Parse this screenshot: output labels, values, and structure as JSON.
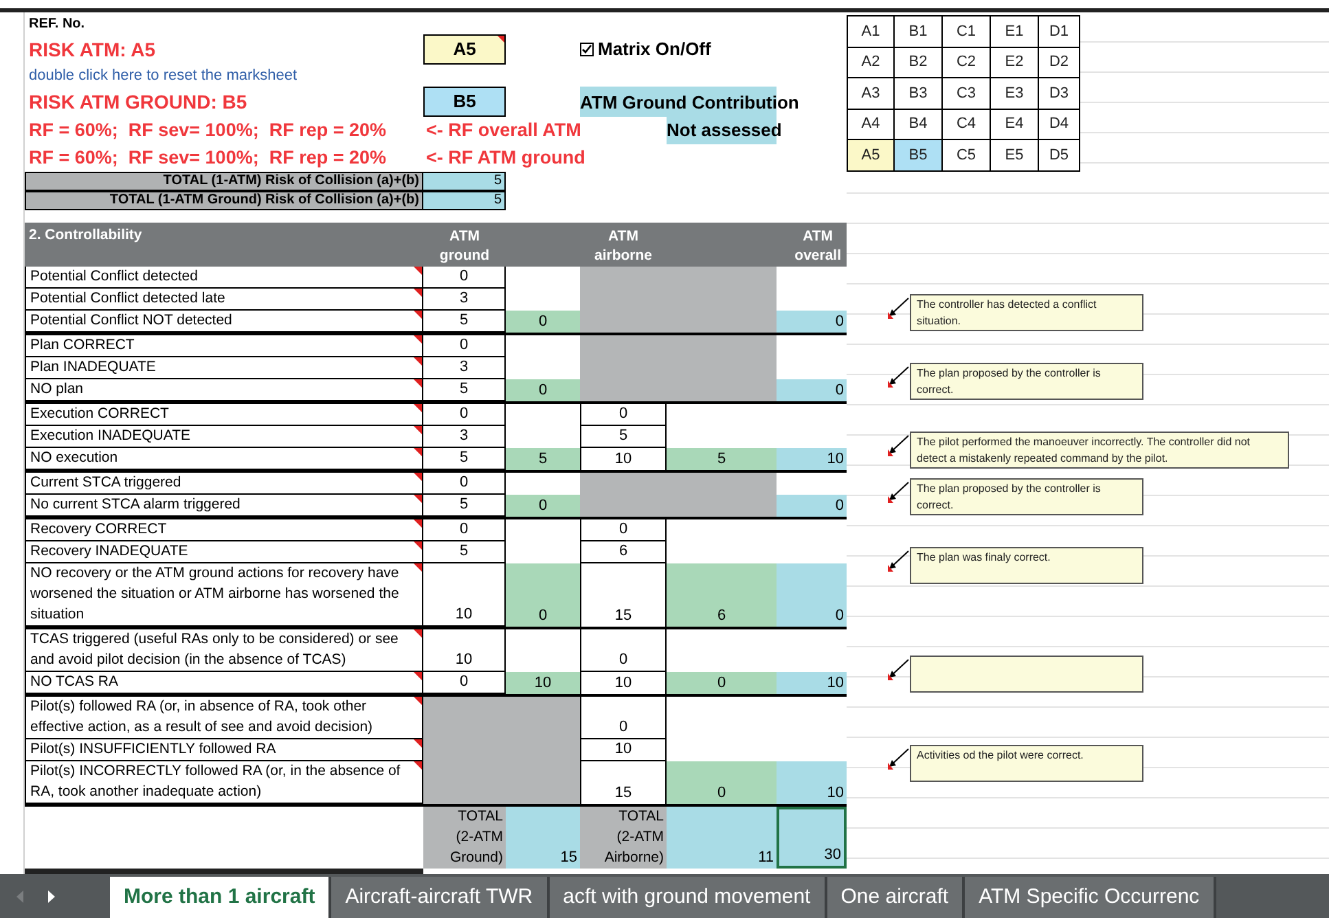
{
  "ref_label": "REF. No.",
  "risk_atm": {
    "label": "RISK ATM: A5",
    "value": "A5"
  },
  "matrix_toggle": {
    "label": "Matrix On/Off",
    "checked": true
  },
  "reset_link": "double click here to reset the marksheet",
  "risk_atm_ground": {
    "label": "RISK ATM GROUND: B5",
    "value": "B5"
  },
  "ground_contribution": {
    "label": "ATM Ground Contribution",
    "status": "Not assessed"
  },
  "rf_rows": [
    {
      "factors": "RF = 60%;  RF sev= 100%;  RF rep = 20%",
      "note": "<- RF overall ATM"
    },
    {
      "factors": "RF = 60%;  RF sev= 100%;  RF rep = 20%",
      "note": "<- RF ATM ground"
    }
  ],
  "collision_totals": [
    {
      "label": "TOTAL (1-ATM) Risk of Collision (a)+(b)",
      "value": "5"
    },
    {
      "label": "TOTAL (1-ATM Ground) Risk of Collision (a)+(b)",
      "value": "5"
    }
  ],
  "matrix": [
    [
      {
        "label": "A1"
      },
      {
        "label": "B1"
      },
      {
        "label": "C1"
      },
      {
        "label": "E1"
      },
      {
        "label": "D1"
      }
    ],
    [
      {
        "label": "A2"
      },
      {
        "label": "B2"
      },
      {
        "label": "C2"
      },
      {
        "label": "E2"
      },
      {
        "label": "D2"
      }
    ],
    [
      {
        "label": "A3"
      },
      {
        "label": "B3"
      },
      {
        "label": "C3"
      },
      {
        "label": "E3"
      },
      {
        "label": "D3"
      }
    ],
    [
      {
        "label": "A4"
      },
      {
        "label": "B4"
      },
      {
        "label": "C4"
      },
      {
        "label": "E4"
      },
      {
        "label": "D4"
      }
    ],
    [
      {
        "label": "A5",
        "color": "#fbf8c8"
      },
      {
        "label": "B5",
        "color": "#aee0f4"
      },
      {
        "label": "C5"
      },
      {
        "label": "E5"
      },
      {
        "label": "D5"
      }
    ]
  ],
  "controllability": {
    "title": "2. Controllability",
    "columns": [
      "ATM ground",
      "ATM airborne",
      "ATM overall"
    ],
    "groups": [
      {
        "airborne_na": true,
        "rows": [
          {
            "label": "Potential Conflict detected",
            "ground": "0"
          },
          {
            "label": "Potential Conflict detected late",
            "ground": "3"
          },
          {
            "label": "Potential Conflict NOT detected",
            "ground": "5",
            "ground_result": "0",
            "overall": "0",
            "comment": {
              "kind": "note",
              "text": "The controller has detected a conflict situation."
            }
          }
        ]
      },
      {
        "airborne_na": true,
        "rows": [
          {
            "label": "Plan CORRECT",
            "ground": "0"
          },
          {
            "label": "Plan INADEQUATE",
            "ground": "3"
          },
          {
            "label": "NO plan",
            "ground": "5",
            "ground_result": "0",
            "overall": "0",
            "comment": {
              "kind": "note",
              "text": "The plan proposed by the controller is correct."
            }
          }
        ]
      },
      {
        "rows": [
          {
            "label": "Execution CORRECT",
            "ground": "0",
            "airborne": "0"
          },
          {
            "label": "Execution INADEQUATE",
            "ground": "3",
            "airborne": "5"
          },
          {
            "label": "NO execution",
            "ground": "5",
            "ground_result": "5",
            "airborne": "10",
            "airborne_result": "5",
            "overall": "10",
            "comment": {
              "kind": "note",
              "text": "The pilot performed the manoeuver incorrectly. The controller did not detect a mistakenly repeated command by the pilot."
            }
          }
        ]
      },
      {
        "airborne_na": true,
        "rows": [
          {
            "label": "Current STCA triggered",
            "ground": "0"
          },
          {
            "label": "No current STCA alarm triggered",
            "ground": "5",
            "ground_result": "0",
            "overall": "0",
            "comment": {
              "kind": "note",
              "text": "The plan proposed by the controller is correct."
            }
          }
        ]
      },
      {
        "rows": [
          {
            "label": "Recovery  CORRECT",
            "ground": "0",
            "airborne": "0"
          },
          {
            "label": "Recovery INADEQUATE",
            "ground": "5",
            "airborne": "6"
          },
          {
            "label": "NO recovery or the ATM ground actions for recovery have worsened the situation or ATM airborne has worsened the situation",
            "ground": "10",
            "ground_result": "0",
            "airborne": "15",
            "airborne_result": "6",
            "overall": "0",
            "comment": {
              "kind": "note",
              "text": "The plan was finaly correct."
            }
          }
        ]
      },
      {
        "rows": [
          {
            "label": "TCAS triggered (useful RAs only to be considered) or see and avoid pilot decision (in the absence of TCAS)",
            "ground": "10",
            "airborne": "0"
          },
          {
            "label": "NO TCAS RA",
            "ground": "0",
            "ground_result": "10",
            "airborne": "10",
            "airborne_result": "0",
            "overall": "10",
            "comment": {
              "kind": "blank"
            }
          }
        ]
      },
      {
        "ground_na": true,
        "rows": [
          {
            "label": "Pilot(s) followed RA (or, in absence of RA, took other effective action, as a result of see and avoid decision)",
            "airborne": "0"
          },
          {
            "label": "Pilot(s) INSUFFICIENTLY followed RA",
            "airborne": "10"
          },
          {
            "label": "Pilot(s) INCORRECTLY followed RA (or, in the absence of RA, took another inadequate action)",
            "airborne": "15",
            "airborne_result": "0",
            "overall": "10",
            "comment": {
              "kind": "note",
              "text": "Activities od the pilot were correct."
            }
          }
        ]
      }
    ],
    "totals": {
      "ground_label": "TOTAL (2-ATM Ground)",
      "ground": "15",
      "airborne_label": "TOTAL (2-ATM Airborne)",
      "airborne": "11",
      "overall": "30"
    }
  },
  "sheet_tabs": [
    {
      "label": "More than 1 aircraft",
      "selected": true
    },
    {
      "label": "Aircraft-aircraft TWR",
      "selected": false
    },
    {
      "label": "acft with ground movement",
      "selected": false
    },
    {
      "label": "One aircraft",
      "selected": false
    },
    {
      "label": "ATM Specific Occurrenc",
      "selected": false
    }
  ]
}
